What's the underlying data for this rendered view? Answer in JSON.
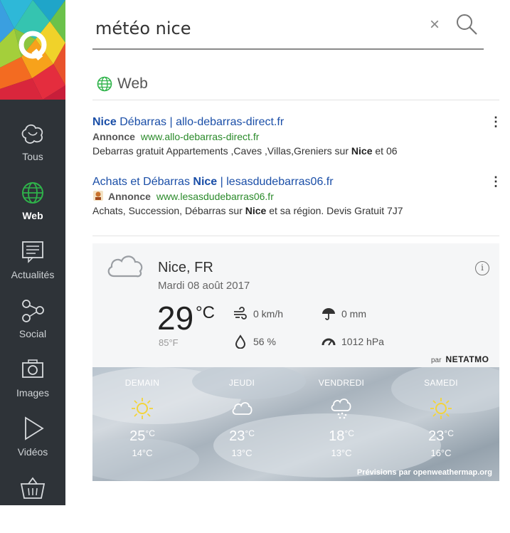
{
  "search": {
    "query": "météo nice",
    "clear_glyph": "×"
  },
  "sidebar": {
    "items": [
      {
        "label": "Tous",
        "icon": "all-icon"
      },
      {
        "label": "Web",
        "icon": "globe-icon"
      },
      {
        "label": "Actualités",
        "icon": "news-icon"
      },
      {
        "label": "Social",
        "icon": "share-icon"
      },
      {
        "label": "Images",
        "icon": "camera-icon"
      },
      {
        "label": "Vidéos",
        "icon": "play-icon"
      },
      {
        "label": "",
        "icon": "basket-icon"
      }
    ],
    "active_index": 1,
    "accent_color": "#2fb34a"
  },
  "section": {
    "title": "Web"
  },
  "ads": [
    {
      "title_bold": "Nice",
      "title_rest": " Débarras | allo-debarras-direct.fr",
      "tag": "Annonce",
      "url": "www.allo-debarras-direct.fr",
      "desc_before": "Debarras gratuit Appartements ,Caves ,Villas,Greniers sur ",
      "desc_bold": "Nice",
      "desc_after": " et 06",
      "menu": "⋮"
    },
    {
      "title_before": "Achats et Débarras ",
      "title_bold": "Nice",
      "title_after": " | lesasdudebarras06.fr",
      "tag": "Annonce",
      "url": "www.lesasdudebarras06.fr",
      "desc_before": "Achats, Succession, Débarras sur ",
      "desc_bold": "Nice",
      "desc_after": " et sa région. Devis Gratuit 7J7",
      "menu": "⋮"
    }
  ],
  "weather": {
    "city": "Nice, FR",
    "date": "Mardi 08 août 2017",
    "temp": "29",
    "unit": "°C",
    "temp_f": "85°F",
    "info": "i",
    "wind": "0 km/h",
    "rain": "0 mm",
    "humidity": "56 %",
    "pressure": "1012 hPa",
    "by_label": "par",
    "by_brand": "NETATMO",
    "forecast": [
      {
        "day": "DEMAIN",
        "icon": "sun-icon",
        "high": "25",
        "low": "14°C"
      },
      {
        "day": "JEUDI",
        "icon": "cloud-icon",
        "high": "23",
        "low": "13°C"
      },
      {
        "day": "VENDREDI",
        "icon": "snow-cloud-icon",
        "high": "18",
        "low": "13°C"
      },
      {
        "day": "SAMEDI",
        "icon": "sun-icon",
        "high": "23",
        "low": "16°C"
      }
    ],
    "unit_small": "°C",
    "credit": "Prévisions par openweathermap.org"
  }
}
